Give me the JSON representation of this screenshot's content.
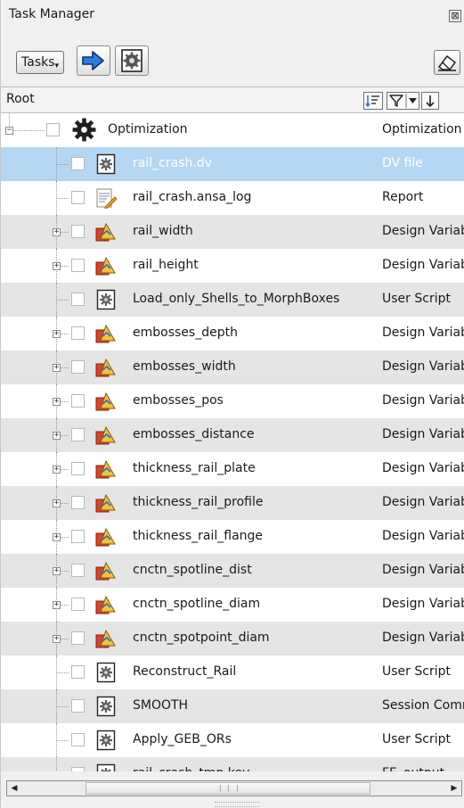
{
  "window": {
    "title": "Task Manager",
    "close_glyph": "⊠"
  },
  "toolbar": {
    "tasks_label": "Tasks",
    "tasks_arrow": "▾"
  },
  "header": {
    "root_label": "Root"
  },
  "colors": {
    "selection": "#b3d7f3",
    "alt_row": "#e5e5e5",
    "accent": "#2a6cc7",
    "design_var_red": "#d8442b",
    "design_var_yellow": "#f4c23d"
  },
  "rows": [
    {
      "name": "Optimization",
      "type": "Optimization",
      "icon": "gear-large-icon",
      "expander": "minus",
      "selected": false
    },
    {
      "name": "rail_crash.dv",
      "type": "DV file",
      "icon": "script-gear-icon",
      "expander": "",
      "selected": true
    },
    {
      "name": "rail_crash.ansa_log",
      "type": "Report",
      "icon": "report-edit-icon",
      "expander": "",
      "selected": false
    },
    {
      "name": "rail_width",
      "type": "Design Variable",
      "icon": "design-variable-icon",
      "expander": "plus",
      "selected": false
    },
    {
      "name": "rail_height",
      "type": "Design Variable",
      "icon": "design-variable-icon",
      "expander": "plus",
      "selected": false
    },
    {
      "name": "Load_only_Shells_to_MorphBoxes",
      "type": "User Script",
      "icon": "script-gear-icon",
      "expander": "",
      "selected": false
    },
    {
      "name": "embosses_depth",
      "type": "Design Variable",
      "icon": "design-variable-icon",
      "expander": "plus",
      "selected": false
    },
    {
      "name": "embosses_width",
      "type": "Design Variable",
      "icon": "design-variable-icon",
      "expander": "plus",
      "selected": false
    },
    {
      "name": "embosses_pos",
      "type": "Design Variable",
      "icon": "design-variable-icon",
      "expander": "plus",
      "selected": false
    },
    {
      "name": "embosses_distance",
      "type": "Design Variable",
      "icon": "design-variable-icon",
      "expander": "plus",
      "selected": false
    },
    {
      "name": "thickness_rail_plate",
      "type": "Design Variable",
      "icon": "design-variable-icon",
      "expander": "plus",
      "selected": false
    },
    {
      "name": "thickness_rail_profile",
      "type": "Design Variable",
      "icon": "design-variable-icon",
      "expander": "plus",
      "selected": false
    },
    {
      "name": "thickness_rail_flange",
      "type": "Design Variable",
      "icon": "design-variable-icon",
      "expander": "plus",
      "selected": false
    },
    {
      "name": "cnctn_spotline_dist",
      "type": "Design Variable",
      "icon": "design-variable-icon",
      "expander": "plus",
      "selected": false
    },
    {
      "name": "cnctn_spotline_diam",
      "type": "Design Variable",
      "icon": "design-variable-icon",
      "expander": "plus",
      "selected": false
    },
    {
      "name": "cnctn_spotpoint_diam",
      "type": "Design Variable",
      "icon": "design-variable-icon",
      "expander": "plus",
      "selected": false
    },
    {
      "name": "Reconstruct_Rail",
      "type": "User Script",
      "icon": "script-gear-icon",
      "expander": "",
      "selected": false
    },
    {
      "name": "SMOOTH",
      "type": "Session Command",
      "icon": "script-gear-icon",
      "expander": "",
      "selected": false
    },
    {
      "name": "Apply_GEB_ORs",
      "type": "User Script",
      "icon": "script-gear-icon",
      "expander": "",
      "selected": false
    },
    {
      "name": "rail_crash_tmp.key",
      "type": "FE_output",
      "icon": "script-gear-icon",
      "expander": "",
      "selected": false
    }
  ],
  "scrollbar": {
    "left_arrow": "◀",
    "right_arrow": "▶"
  }
}
